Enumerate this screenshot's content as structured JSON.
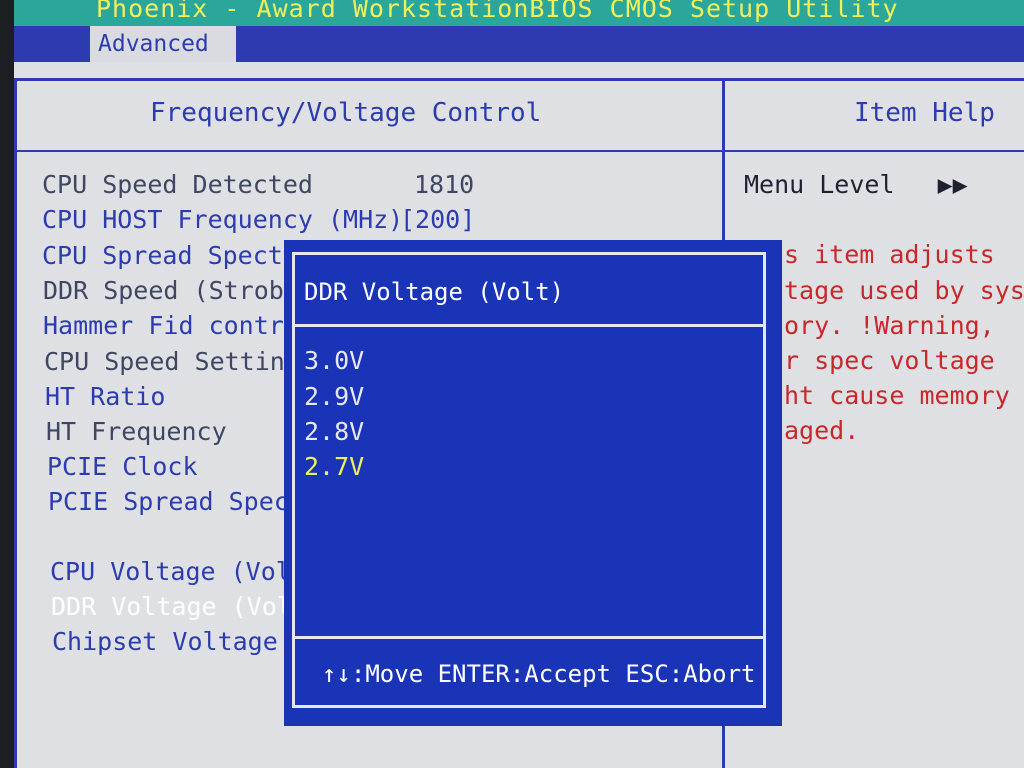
{
  "app_title": "Phoenix - Award WorkstationBIOS CMOS Setup Utility",
  "menu": {
    "active_tab": "Advanced"
  },
  "panel": {
    "title": "Frequency/Voltage Control",
    "help_title": "Item Help"
  },
  "settings": [
    {
      "label": "CPU Speed Detected",
      "value": "1810"
    },
    {
      "label": "CPU HOST Frequency (MHz)",
      "value": "[200]"
    },
    {
      "label": "CPU Spread Spectr"
    },
    {
      "label": "DDR Speed (Strobe"
    },
    {
      "label": "Hammer Fid contro"
    },
    {
      "label": "CPU Speed Setting"
    },
    {
      "label": "HT Ratio"
    },
    {
      "label": "HT Frequency"
    },
    {
      "label": "PCIE Clock"
    },
    {
      "label": "PCIE Spread Spect"
    },
    {
      "label": "CPU Voltage (Volt"
    },
    {
      "label": "DDR Voltage (Volt"
    },
    {
      "label": "Chipset Voltage ("
    }
  ],
  "help": {
    "menu_level": "Menu Level",
    "menu_level_glyph": "▶▶",
    "lines": [
      "s item adjusts",
      "tage used by syste",
      "ory. !Warning,",
      "r spec voltage",
      "ht cause memory",
      "aged."
    ]
  },
  "popup": {
    "title": "DDR Voltage (Volt)",
    "options": [
      "3.0V",
      "2.9V",
      "2.8V",
      "2.7V"
    ],
    "selected_index": 3,
    "footer": "↑↓:Move ENTER:Accept ESC:Abort"
  }
}
